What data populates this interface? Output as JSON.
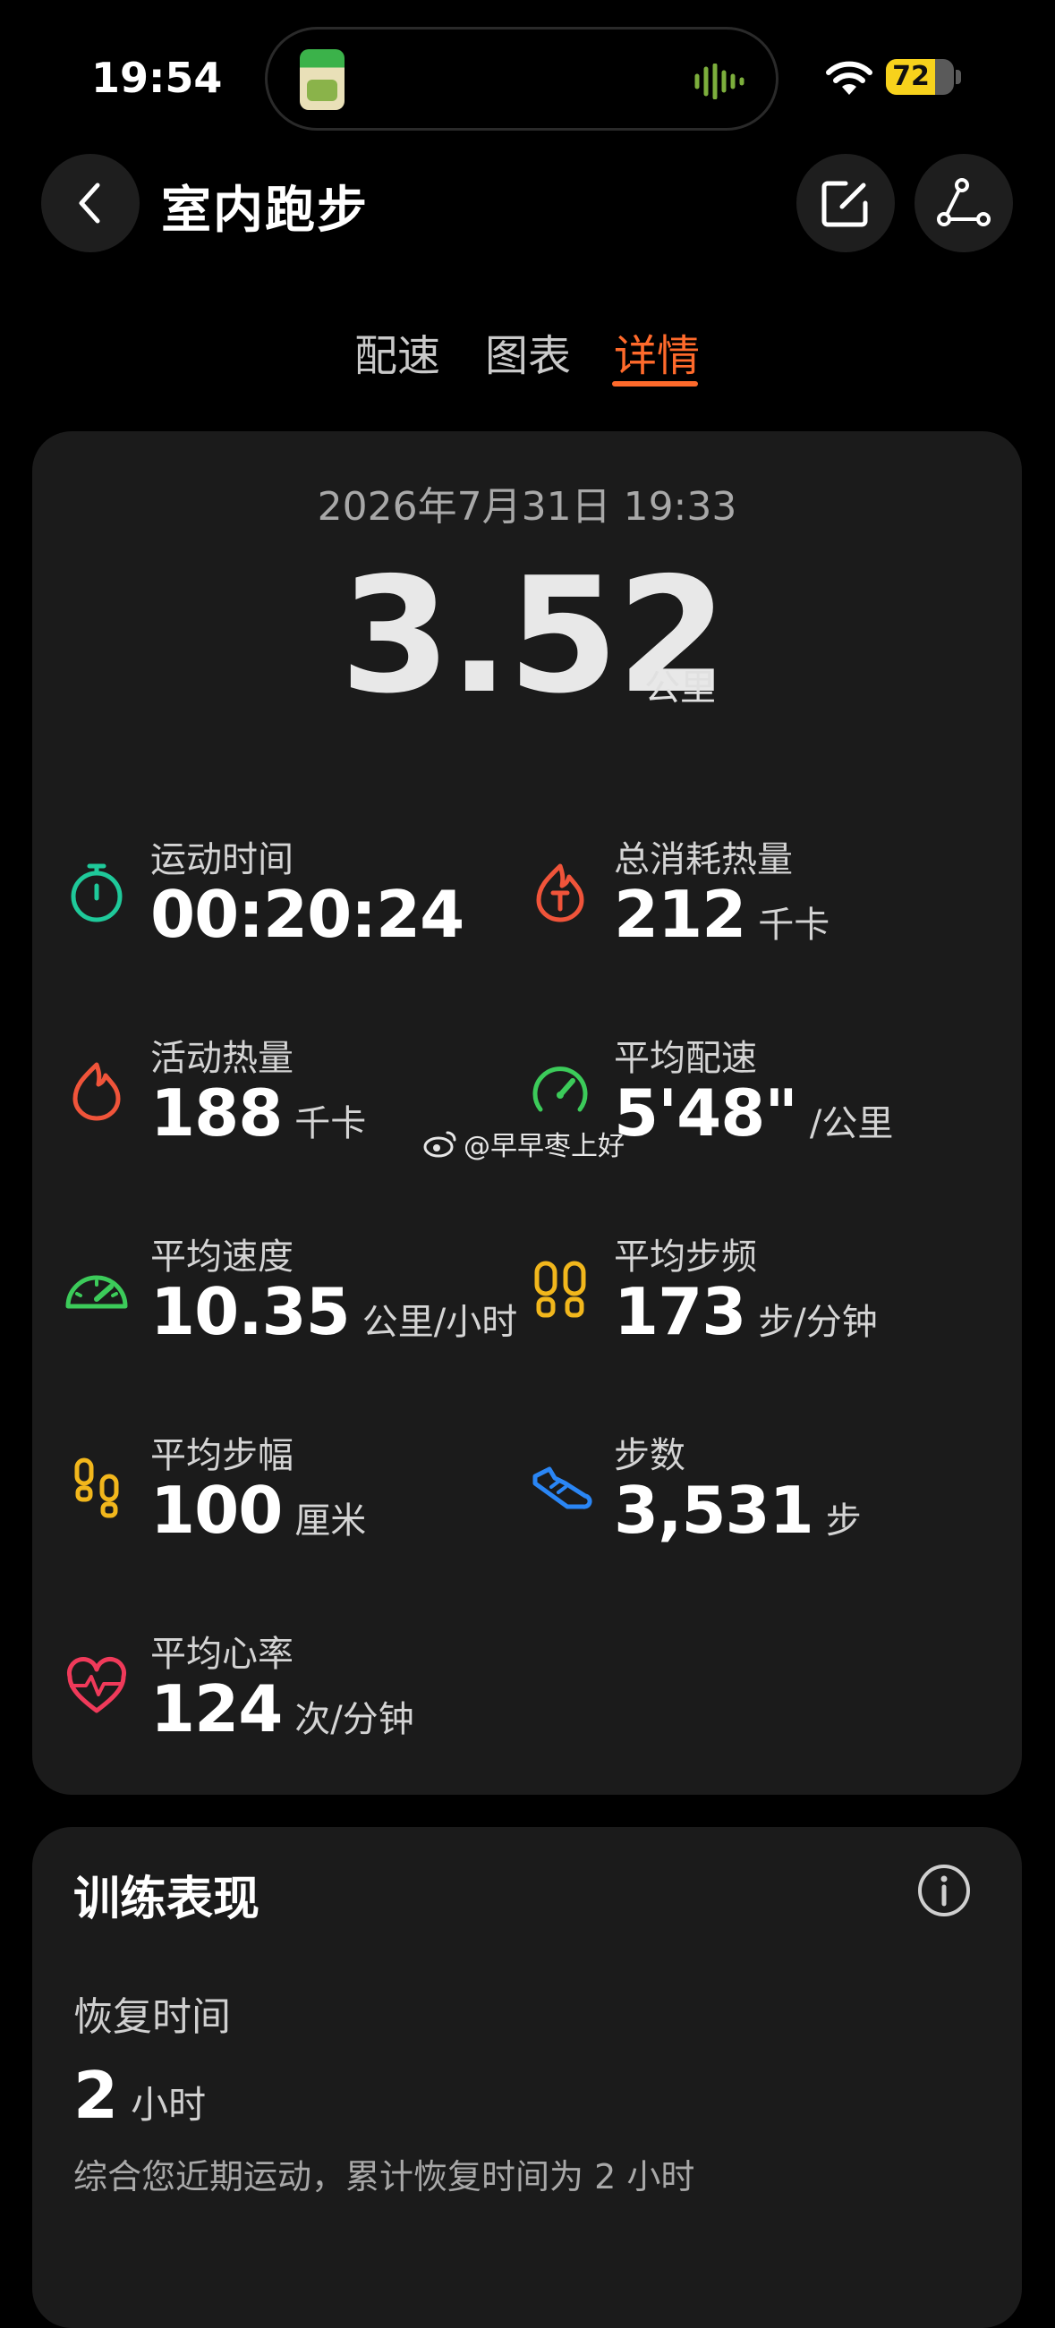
{
  "status_bar": {
    "time": "19:54",
    "battery": "72",
    "battery_level_percent": 72,
    "icons": [
      "wifi-icon",
      "battery-icon",
      "audio-wave-icon"
    ]
  },
  "header": {
    "title": "室内跑步",
    "back_icon": "chevron-left-icon",
    "edit_icon": "edit-icon",
    "share_icon": "route-share-icon"
  },
  "tabs": [
    {
      "label": "配速",
      "active": false
    },
    {
      "label": "图表",
      "active": false
    },
    {
      "label": "详情",
      "active": true
    }
  ],
  "summary": {
    "date": "2026年7月31日 19:33",
    "distance": "3.52",
    "distance_unit": "公里",
    "metrics": [
      {
        "label": "运动时间",
        "value": "00:20:24",
        "unit": "",
        "icon": "stopwatch-icon",
        "color": "#1fc99a"
      },
      {
        "label": "总消耗热量",
        "value": "212",
        "unit": "千卡",
        "icon": "calorie-flame-icon",
        "color": "#f0543a"
      },
      {
        "label": "活动热量",
        "value": "188",
        "unit": "千卡",
        "icon": "flame-icon",
        "color": "#f0543a"
      },
      {
        "label": "平均配速",
        "value": "5'48\"",
        "unit": "/公里",
        "icon": "speedometer-icon",
        "color": "#3ccb5a"
      },
      {
        "label": "平均速度",
        "value": "10.35",
        "unit": "公里/小时",
        "icon": "speed-gauge-icon",
        "color": "#3ccb5a"
      },
      {
        "label": "平均步频",
        "value": "173",
        "unit": "步/分钟",
        "icon": "footprints-icon",
        "color": "#f2b71c"
      },
      {
        "label": "平均步幅",
        "value": "100",
        "unit": "厘米",
        "icon": "footsteps-icon",
        "color": "#f2b71c"
      },
      {
        "label": "步数",
        "value": "3,531",
        "unit": "步",
        "icon": "shoe-icon",
        "color": "#2a86f5"
      },
      {
        "label": "平均心率",
        "value": "124",
        "unit": "次/分钟",
        "icon": "heart-rate-icon",
        "color": "#f03a5a"
      }
    ]
  },
  "watermark": "@早早枣上好",
  "training": {
    "title": "训练表现",
    "info_icon": "info-icon",
    "recovery_label": "恢复时间",
    "recovery_value": "2",
    "recovery_unit": "小时",
    "recovery_desc": "综合您近期运动，累计恢复时间为 2 小时"
  },
  "colors": {
    "accent": "#ff6a2b",
    "background": "#000000",
    "card": "#1b1b1b"
  }
}
